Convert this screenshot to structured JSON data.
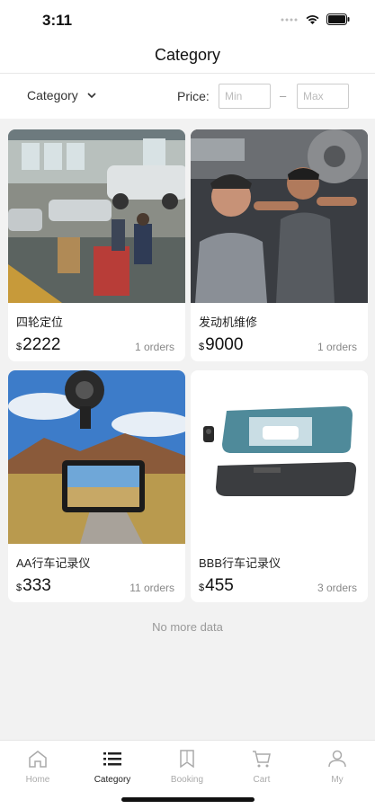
{
  "status": {
    "time": "3:11"
  },
  "header": {
    "title": "Category"
  },
  "filter": {
    "category_label": "Category",
    "price_label": "Price:",
    "min_placeholder": "Min",
    "max_placeholder": "Max",
    "dash": "–"
  },
  "products": [
    {
      "name": "四轮定位",
      "currency": "$",
      "price": "2222",
      "orders": "1 orders"
    },
    {
      "name": "发动机维修",
      "currency": "$",
      "price": "9000",
      "orders": "1 orders"
    },
    {
      "name": "AA行车记录仪",
      "currency": "$",
      "price": "333",
      "orders": "11 orders"
    },
    {
      "name": "BBB行车记录仪",
      "currency": "$",
      "price": "455",
      "orders": "3 orders"
    }
  ],
  "no_more": "No more data",
  "tabbar": {
    "home": "Home",
    "category": "Category",
    "booking": "Booking",
    "cart": "Cart",
    "my": "My",
    "active": "category"
  },
  "colors": {
    "active_tab": "#222222",
    "inactive_tab": "#aaaaaa",
    "background": "#f2f2f2"
  }
}
